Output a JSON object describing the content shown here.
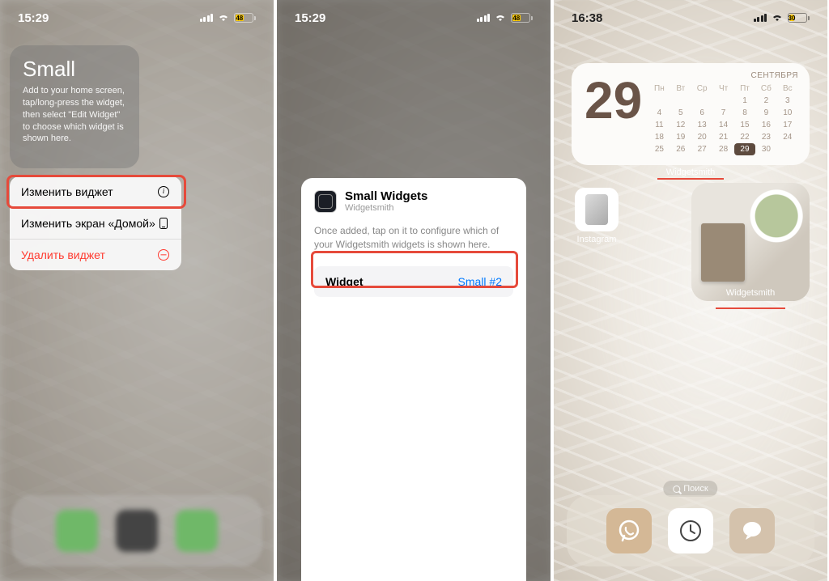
{
  "phone1": {
    "time": "15:29",
    "battery": "48",
    "widget": {
      "title": "Small",
      "desc": "Add to your home screen, tap/long-press the widget, then select \"Edit Widget\" to choose which widget is shown here."
    },
    "menu": {
      "edit_widget": "Изменить виджет",
      "edit_home": "Изменить экран «Домой»",
      "delete_widget": "Удалить виджет"
    }
  },
  "phone2": {
    "time": "15:29",
    "battery": "48",
    "sheet": {
      "title": "Small Widgets",
      "subtitle": "Widgetsmith",
      "desc": "Once added, tap on it to configure which of your Widgetsmith widgets is shown here.",
      "row_label": "Widget",
      "row_value": "Small #2"
    }
  },
  "phone3": {
    "time": "16:38",
    "battery": "30",
    "calendar": {
      "month": "СЕНТЯБРЯ",
      "big_day": "29",
      "weekdays": [
        "Пн",
        "Вт",
        "Ср",
        "Чт",
        "Пт",
        "Сб",
        "Вс"
      ],
      "weeks": [
        [
          "",
          "",
          "",
          "",
          "1",
          "2",
          "3"
        ],
        [
          "4",
          "5",
          "6",
          "7",
          "8",
          "9",
          "10"
        ],
        [
          "11",
          "12",
          "13",
          "14",
          "15",
          "16",
          "17"
        ],
        [
          "18",
          "19",
          "20",
          "21",
          "22",
          "23",
          "24"
        ],
        [
          "25",
          "26",
          "27",
          "28",
          "29",
          "30",
          ""
        ]
      ],
      "today": "29"
    },
    "widgetsmith_label": "Widgetsmith",
    "instagram_label": "Instagram",
    "photo_widget_label": "Widgetsmith",
    "search_label": "Поиск"
  }
}
